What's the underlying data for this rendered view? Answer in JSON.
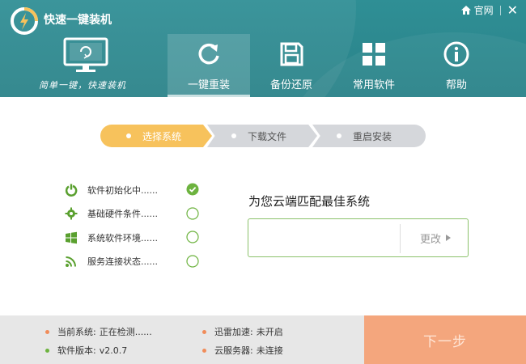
{
  "app": {
    "title": "快速一键装机",
    "slogan": "简单一键，快速装机"
  },
  "topbar": {
    "home_label": "官网",
    "close_label": "✕"
  },
  "nav": [
    {
      "label": "一键重装",
      "icon": "refresh-icon",
      "active": true
    },
    {
      "label": "备份还原",
      "icon": "floppy-disk-icon",
      "active": false
    },
    {
      "label": "常用软件",
      "icon": "apps-grid-icon",
      "active": false
    },
    {
      "label": "帮助",
      "icon": "info-icon",
      "active": false
    }
  ],
  "steps": [
    {
      "label": "选择系统",
      "active": true
    },
    {
      "label": "下载文件",
      "active": false
    },
    {
      "label": "重启安装",
      "active": false
    }
  ],
  "checks": [
    {
      "label": "软件初始化中......",
      "icon": "power-icon",
      "done": true
    },
    {
      "label": "基础硬件条件......",
      "icon": "cog-icon",
      "done": false
    },
    {
      "label": "系统软件环境......",
      "icon": "windows-icon",
      "done": false
    },
    {
      "label": "服务连接状态......",
      "icon": "signal-icon",
      "done": false
    }
  ],
  "match": {
    "title": "为您云端匹配最佳系统",
    "input_value": "",
    "change_label": "更改"
  },
  "footer": {
    "current_system_key": "当前系统:",
    "current_system_value": "正在检测......",
    "version_key": "软件版本:",
    "version_value": "v2.0.7",
    "thunder_key": "迅雷加速:",
    "thunder_value": "未开启",
    "cloud_key": "云服务器:",
    "cloud_value": "未连接",
    "next_label": "下一步"
  },
  "colors": {
    "header": "#2a8289",
    "step_active": "#f7c25c",
    "step_inactive": "#d5d7db",
    "check_green": "#6db33f",
    "next_button": "#f4a67d",
    "bullet_orange": "#f08c5a",
    "bullet_green": "#6db33f"
  }
}
